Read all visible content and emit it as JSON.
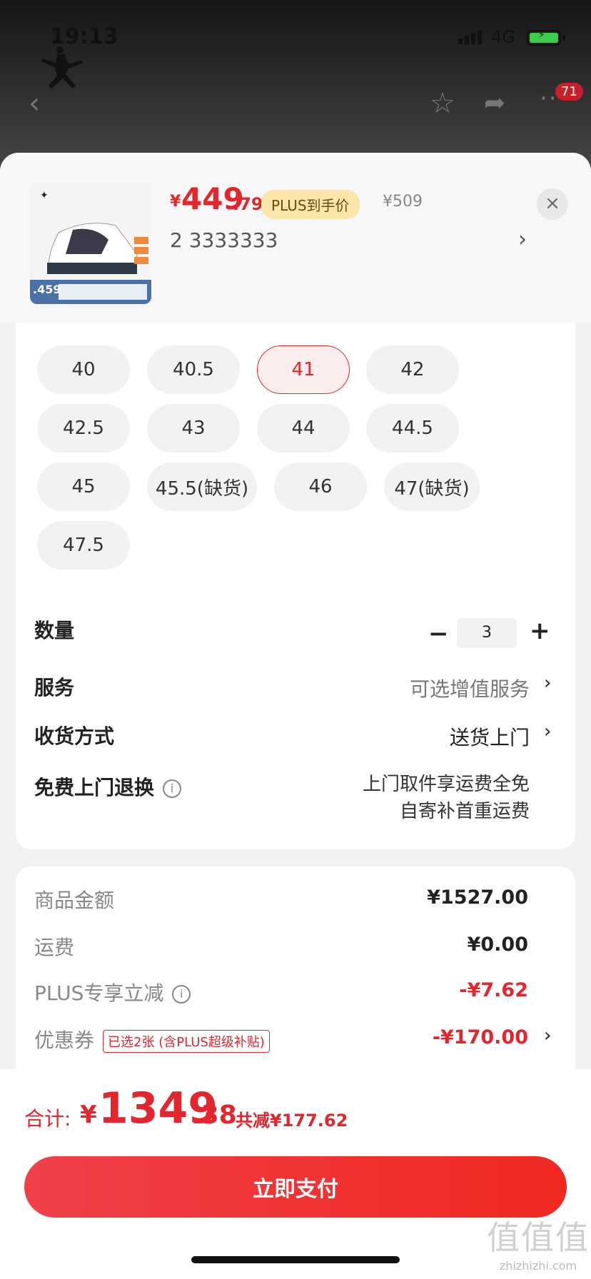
{
  "status": {
    "time": "19:13",
    "network": "4G"
  },
  "nav": {
    "back_icon": "chevron-left-icon",
    "star_icon": "star-icon",
    "share_icon": "share-icon",
    "more_icon": "more-icon",
    "more_badge": "71"
  },
  "product": {
    "thumb_price": ".459",
    "price_symbol": "¥",
    "price_int": "449",
    "price_dec": ".79",
    "plus_badge": "PLUS到手价",
    "original_price": "¥509",
    "spec": "2  3333333",
    "spec_arrow": "›",
    "close": "×"
  },
  "sizes": [
    {
      "label": "40",
      "selected": false
    },
    {
      "label": "40.5",
      "selected": false
    },
    {
      "label": "41",
      "selected": true
    },
    {
      "label": "42",
      "selected": false
    },
    {
      "label": "42.5",
      "selected": false
    },
    {
      "label": "43",
      "selected": false
    },
    {
      "label": "44",
      "selected": false
    },
    {
      "label": "44.5",
      "selected": false
    },
    {
      "label": "45",
      "selected": false
    },
    {
      "label": "45.5(缺货)",
      "selected": false
    },
    {
      "label": "46",
      "selected": false
    },
    {
      "label": "47(缺货)",
      "selected": false
    },
    {
      "label": "47.5",
      "selected": false
    }
  ],
  "quantity": {
    "label": "数量",
    "minus": "−",
    "value": "3",
    "plus": "+"
  },
  "service": {
    "label": "服务",
    "value": "可选增值服务",
    "arrow": "›"
  },
  "delivery": {
    "label": "收货方式",
    "value": "送货上门",
    "arrow": "›"
  },
  "returns": {
    "label": "免费上门退换",
    "info": "i",
    "line1": "上门取件享运费全免",
    "line2": "自寄补首重运费"
  },
  "fees": {
    "goods_label": "商品金额",
    "goods_value": "¥1527.00",
    "shipping_label": "运费",
    "shipping_value": "¥0.00",
    "plus_label": "PLUS专享立减",
    "plus_value": "-¥7.62",
    "coupon_label": "优惠券",
    "coupon_tag": "已选2张 (含PLUS超级补贴)",
    "coupon_value": "-¥170.00",
    "coupon_arrow": "›"
  },
  "total": {
    "label": "合计:",
    "symbol": "¥",
    "int": "1349",
    "dec": ".38",
    "save": "共减¥177.62"
  },
  "pay_button": "立即支付",
  "watermark": {
    "logo": "值值值",
    "text": "zhizhizhi.com"
  }
}
